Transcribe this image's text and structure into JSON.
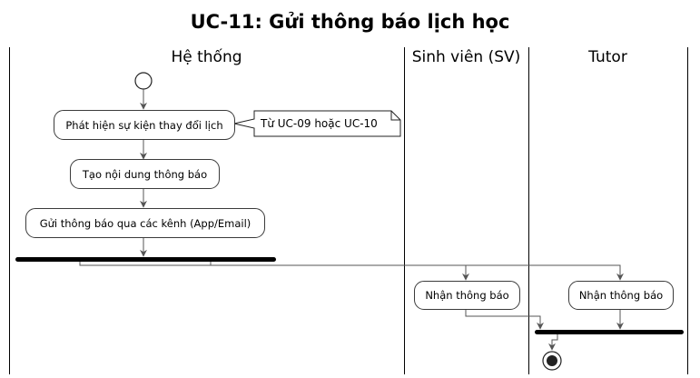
{
  "diagram": {
    "title": "UC-11: Gửi thông báo lịch học",
    "lanes": [
      {
        "id": "he-thong",
        "label": "Hệ thống"
      },
      {
        "id": "sinh-vien",
        "label": "Sinh viên (SV)"
      },
      {
        "id": "tutor",
        "label": "Tutor"
      }
    ],
    "actions": {
      "detect": "Phát hiện sự kiện thay đổi lịch",
      "create": "Tạo nội dung thông báo",
      "send": "Gửi thông báo qua các kênh (App/Email)",
      "sv_receive": "Nhận thông báo",
      "tutor_receive": "Nhận thông báo"
    },
    "note": "Từ UC-09 hoặc UC-10",
    "colors": {
      "line": "#555555",
      "border": "#3b3b3b",
      "bar": "#000000"
    }
  }
}
